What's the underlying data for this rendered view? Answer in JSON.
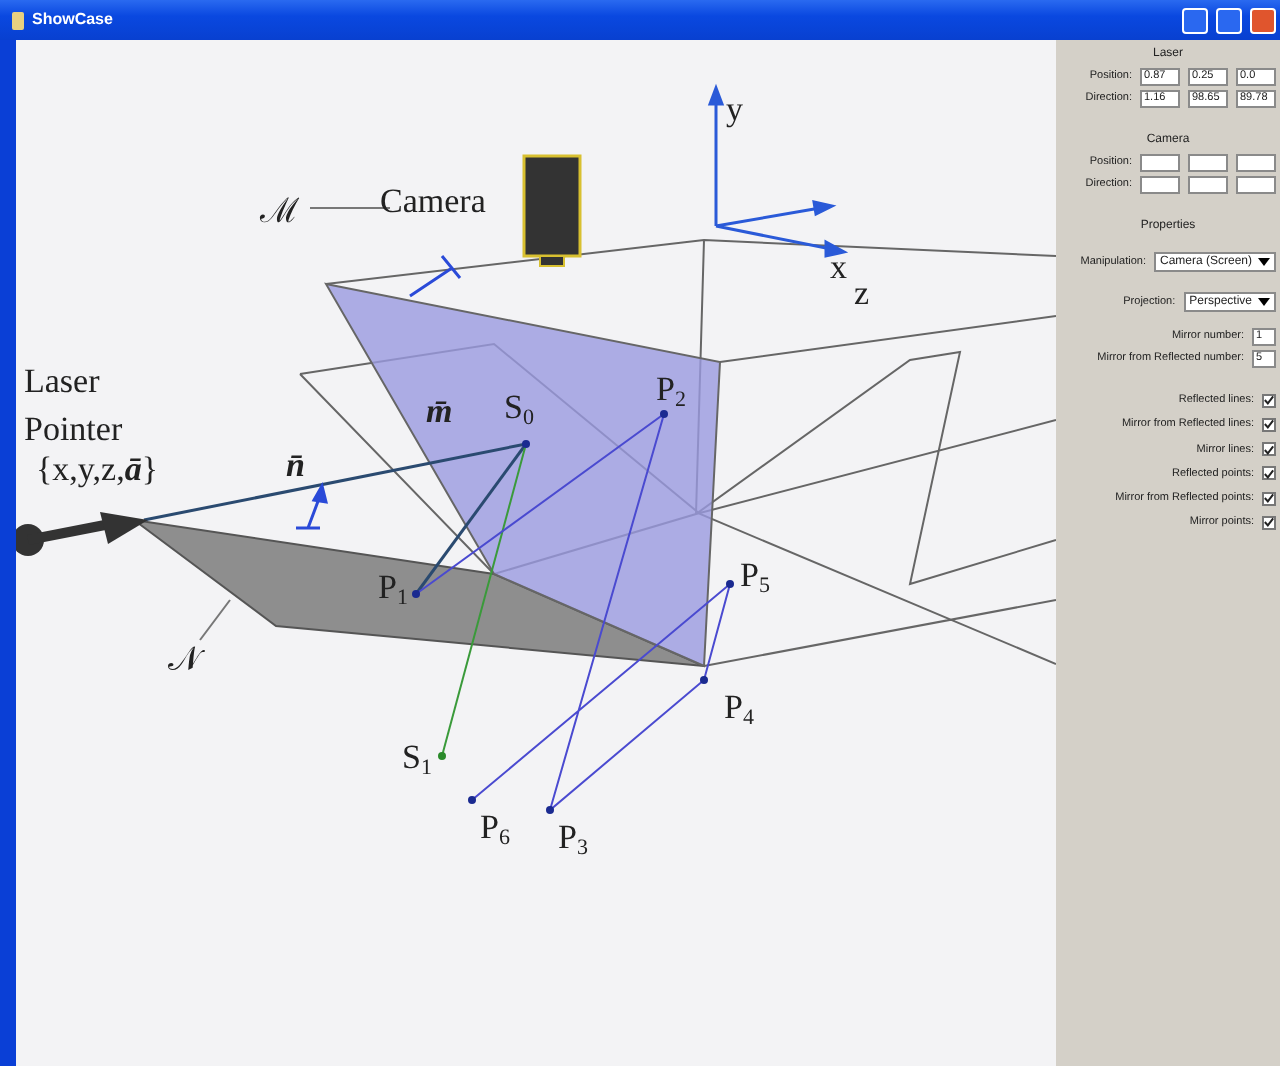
{
  "window": {
    "title": "ShowCase"
  },
  "scene": {
    "labels": [
      {
        "text": "y"
      },
      {
        "text": "ℳ"
      },
      {
        "text": "Camera"
      },
      {
        "text": "x"
      },
      {
        "text": "z"
      },
      {
        "text": "Laser"
      },
      {
        "text": "Pointer"
      },
      {
        "text": "{x,y,z,**ā**}"
      },
      {
        "text": "**m̄**"
      },
      {
        "text": "S$_{0}$"
      },
      {
        "text": "P$_{2}$"
      },
      {
        "text": "**n̄**"
      },
      {
        "text": "P$_{1}$"
      },
      {
        "text": "P$_{5}$"
      },
      {
        "text": "𝒩"
      },
      {
        "text": "P$_{4}$"
      },
      {
        "text": "S$_{1}$"
      },
      {
        "text": "P$_{6}$"
      },
      {
        "text": "P$_{3}$"
      }
    ]
  },
  "panel": {
    "laser": {
      "heading": "Laser",
      "rows": [
        {
          "label": "Position:",
          "values": [
            "0.87",
            "0.25",
            "0.0"
          ]
        },
        {
          "label": "Direction:",
          "values": [
            "1.16",
            "98.65",
            "89.78"
          ]
        }
      ]
    },
    "camera": {
      "heading": "Camera",
      "rows": [
        {
          "label": "Position:"
        },
        {
          "label": "Direction:"
        }
      ]
    },
    "properties": {
      "heading": "Properties",
      "combos": [
        {
          "label": "Manipulation:",
          "value": "Camera (Screen)"
        },
        {
          "label": "Projection:",
          "value": "Perspective"
        }
      ],
      "numbers": [
        {
          "label": "Mirror number:",
          "value": "1"
        },
        {
          "label": "Mirror from Reflected number:",
          "value": "5"
        }
      ],
      "checkboxes": [
        {
          "label": "Reflected lines:",
          "checked": true
        },
        {
          "label": "Mirror from Reflected lines:",
          "checked": true
        },
        {
          "label": "Mirror lines:",
          "checked": true
        },
        {
          "label": "Reflected points:",
          "checked": true
        },
        {
          "label": "Mirror from Reflected points:",
          "checked": true
        },
        {
          "label": "Mirror points:",
          "checked": true
        }
      ]
    }
  }
}
